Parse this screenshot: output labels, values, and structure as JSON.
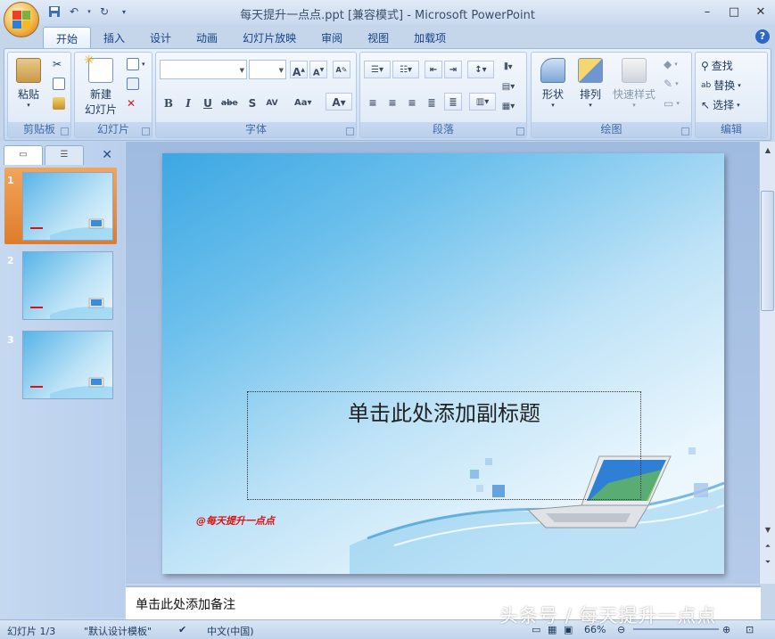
{
  "window": {
    "title": "每天提升一点点.ppt [兼容模式] - Microsoft PowerPoint"
  },
  "ribbon": {
    "tabs": [
      "开始",
      "插入",
      "设计",
      "动画",
      "幻灯片放映",
      "审阅",
      "视图",
      "加载项"
    ],
    "active_tab": "开始",
    "groups": {
      "clipboard": {
        "label": "剪贴板",
        "paste": "粘贴"
      },
      "slides": {
        "label": "幻灯片",
        "new_slide_line1": "新建",
        "new_slide_line2": "幻灯片"
      },
      "font": {
        "label": "字体",
        "font_name": "",
        "font_size": ""
      },
      "paragraph": {
        "label": "段落"
      },
      "drawing": {
        "label": "绘图",
        "shapes": "形状",
        "arrange": "排列",
        "quick_styles": "快速样式"
      },
      "editing": {
        "label": "编辑",
        "find": "查找",
        "replace": "替换",
        "select": "选择"
      }
    }
  },
  "slides_pane": {
    "thumbnails": [
      {
        "num": "1"
      },
      {
        "num": "2"
      },
      {
        "num": "3"
      }
    ]
  },
  "slide": {
    "subtitle_placeholder": "单击此处添加副标题",
    "watermark": "@每天提升一点点"
  },
  "notes": {
    "placeholder": "单击此处添加备注"
  },
  "statusbar": {
    "slide_counter": "幻灯片 1/3",
    "theme": "\"默认设计模板\"",
    "language": "中文(中国)",
    "zoom": "66%"
  },
  "overlay_watermark": "头条号 / 每天提升一点点",
  "colors": {
    "accent": "#e08e39",
    "ribbon_bg": "#d2e1f5"
  }
}
